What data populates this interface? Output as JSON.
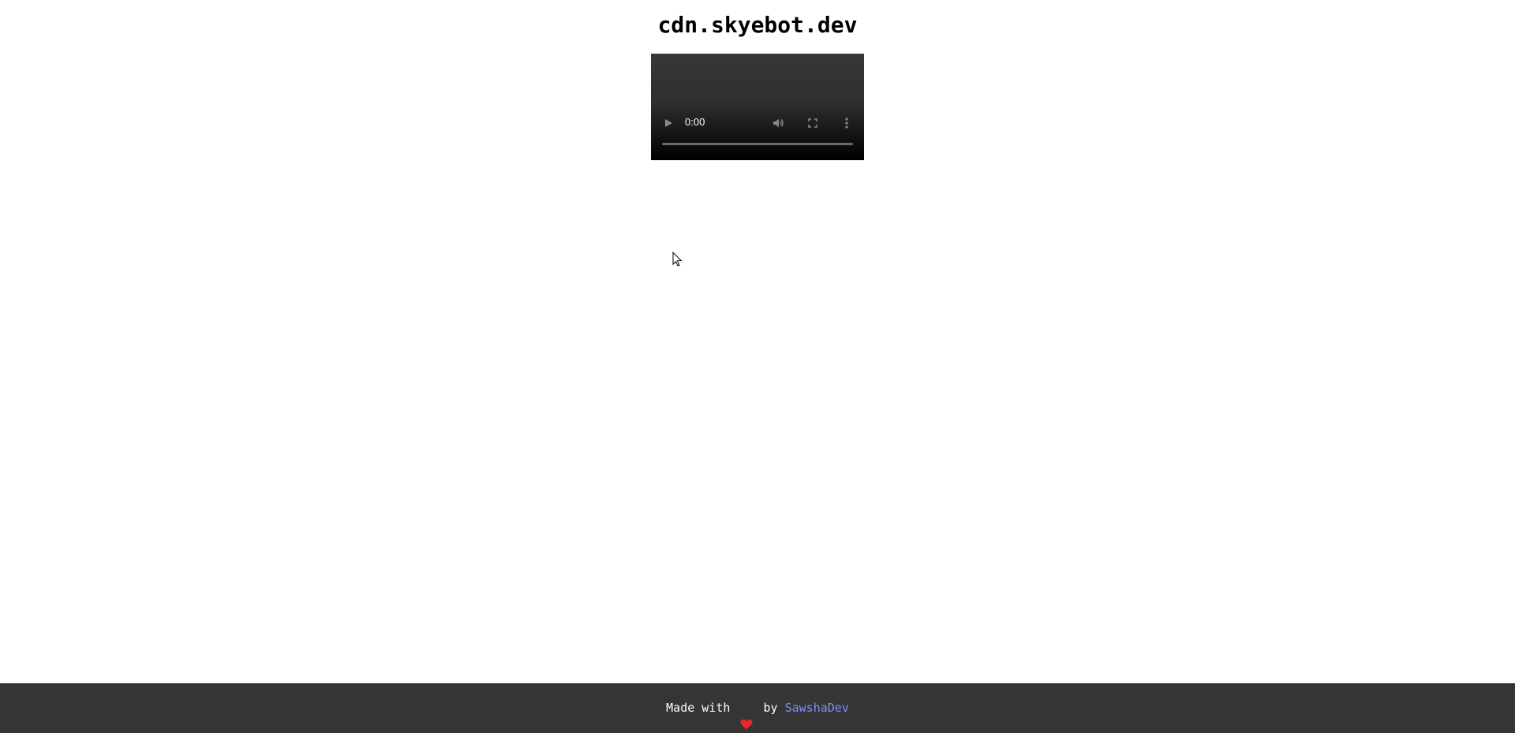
{
  "header": {
    "title": "cdn.skyebot.dev"
  },
  "video": {
    "time": "0:00",
    "progress": 0,
    "icons": {
      "play": "play-icon",
      "volume": "volume-icon",
      "fullscreen": "fullscreen-icon",
      "more": "more-options-icon"
    }
  },
  "footer": {
    "prefix": "Made with",
    "heart_icon": "heart-icon",
    "heart_color": "#e8262b",
    "middle": "by",
    "link_text": "SawshaDev",
    "link_color": "#7e8ef0",
    "background_color": "#353535"
  }
}
